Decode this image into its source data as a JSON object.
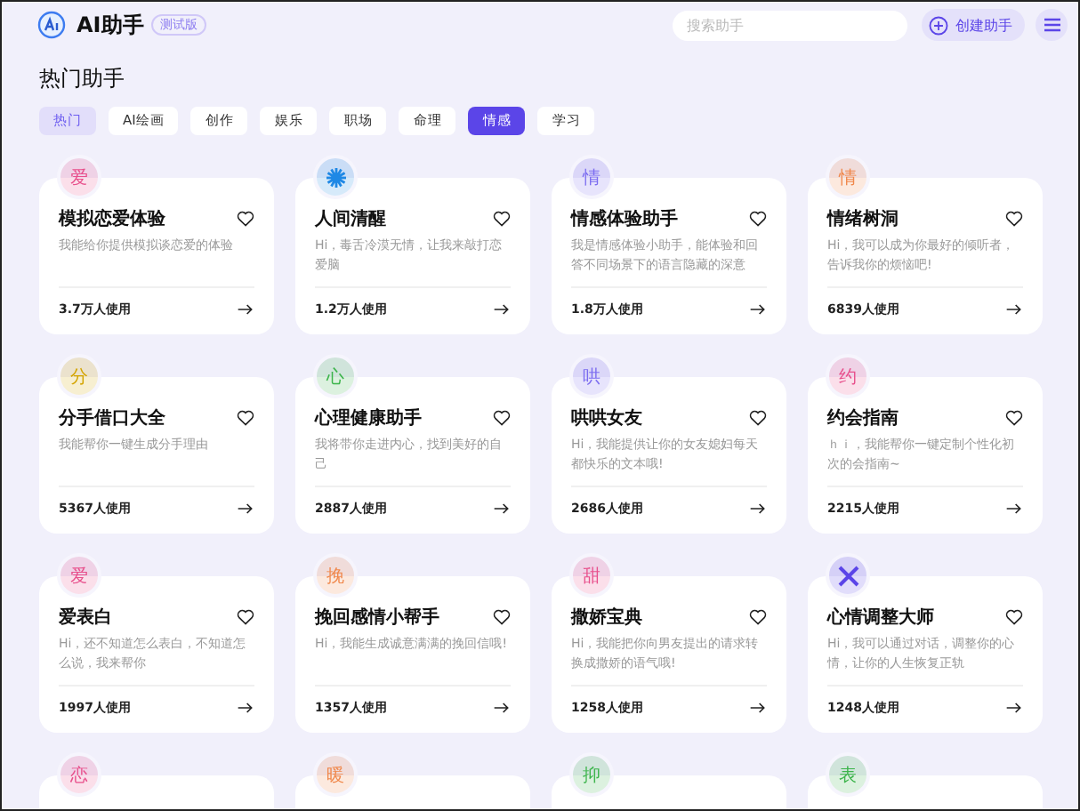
{
  "header": {
    "logo_text": "AI助手",
    "badge": "测试版",
    "search": {
      "placeholder": "搜索助手"
    },
    "create_button": "创建助手"
  },
  "section_title": "热门助手",
  "tabs": [
    {
      "label": "热门",
      "selected": false,
      "hovered": true
    },
    {
      "label": "AI绘画",
      "selected": false,
      "hovered": false
    },
    {
      "label": "创作",
      "selected": false,
      "hovered": false
    },
    {
      "label": "娱乐",
      "selected": false,
      "hovered": false
    },
    {
      "label": "职场",
      "selected": false,
      "hovered": false
    },
    {
      "label": "命理",
      "selected": false,
      "hovered": false
    },
    {
      "label": "情感",
      "selected": true,
      "hovered": false
    },
    {
      "label": "学习",
      "selected": false,
      "hovered": false
    }
  ],
  "cards": [
    {
      "avatar": {
        "kind": "char",
        "char": "爱",
        "color": "#e8508c"
      },
      "title": "模拟恋爱体验",
      "description": "我能给你提供模拟谈恋爱的体验",
      "usage": "3.7万人使用"
    },
    {
      "avatar": {
        "kind": "burst",
        "color": "#1e88e5"
      },
      "title": "人间清醒",
      "description": "Hi，毒舌冷漠无情，让我来敲打恋爱脑",
      "usage": "1.2万人使用"
    },
    {
      "avatar": {
        "kind": "char",
        "char": "情",
        "color": "#7b6cf0"
      },
      "title": "情感体验助手",
      "description": "我是情感体验小助手，能体验和回答不同场景下的语言隐藏的深意",
      "usage": "1.8万人使用"
    },
    {
      "avatar": {
        "kind": "char",
        "char": "情",
        "color": "#f0874a"
      },
      "title": "情绪树洞",
      "description": "Hi，我可以成为你最好的倾听者，告诉我你的烦恼吧!",
      "usage": "6839人使用"
    },
    {
      "avatar": {
        "kind": "char",
        "char": "分",
        "color": "#d4a500"
      },
      "title": "分手借口大全",
      "description": "我能帮你一键生成分手理由",
      "usage": "5367人使用"
    },
    {
      "avatar": {
        "kind": "char",
        "char": "心",
        "color": "#3cb44b"
      },
      "title": "心理健康助手",
      "description": "我将带你走进内心，找到美好的自己",
      "usage": "2887人使用"
    },
    {
      "avatar": {
        "kind": "char",
        "char": "哄",
        "color": "#7b6cf0"
      },
      "title": "哄哄女友",
      "description": "Hi，我能提供让你的女友媳妇每天都快乐的文本哦!",
      "usage": "2686人使用"
    },
    {
      "avatar": {
        "kind": "char",
        "char": "约",
        "color": "#e8508c"
      },
      "title": "约会指南",
      "description": "ｈｉ，我能帮你一键定制个性化初次的会指南~",
      "usage": "2215人使用"
    },
    {
      "avatar": {
        "kind": "char",
        "char": "爱",
        "color": "#e8508c"
      },
      "title": "爱表白",
      "description": "Hi，还不知道怎么表白，不知道怎么说，我来帮你",
      "usage": "1997人使用"
    },
    {
      "avatar": {
        "kind": "char",
        "char": "挽",
        "color": "#f0874a"
      },
      "title": "挽回感情小帮手",
      "description": "Hi，我能生成诚意满满的挽回信哦!",
      "usage": "1357人使用"
    },
    {
      "avatar": {
        "kind": "char",
        "char": "甜",
        "color": "#e8508c"
      },
      "title": "撒娇宝典",
      "description": "Hi，我能把你向男友提出的请求转换成撒娇的语气哦!",
      "usage": "1258人使用"
    },
    {
      "avatar": {
        "kind": "cross",
        "color": "#5b45e8"
      },
      "title": "心情调整大师",
      "description": "Hi，我可以通过对话，调整你的心情，让你的人生恢复正轨",
      "usage": "1248人使用"
    },
    {
      "avatar": {
        "kind": "char",
        "char": "恋",
        "color": "#e8508c"
      }
    },
    {
      "avatar": {
        "kind": "char",
        "char": "暖",
        "color": "#f0874a"
      }
    },
    {
      "avatar": {
        "kind": "char",
        "char": "抑",
        "color": "#3cb44b"
      }
    },
    {
      "avatar": {
        "kind": "char",
        "char": "表",
        "color": "#3cb44b"
      }
    }
  ]
}
